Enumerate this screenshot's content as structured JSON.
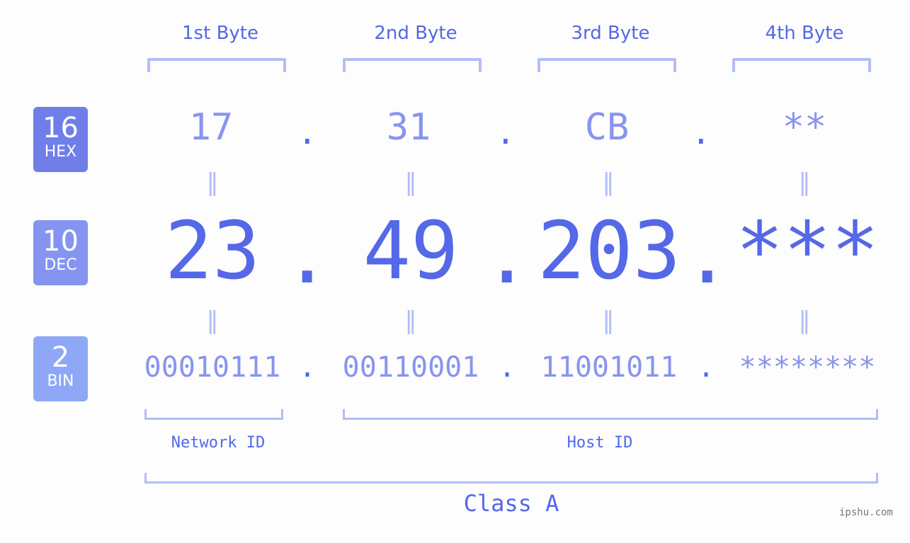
{
  "bytes": [
    {
      "header": "1st Byte",
      "hex": "17",
      "dec": "23",
      "bin": "00010111"
    },
    {
      "header": "2nd Byte",
      "hex": "31",
      "dec": "49",
      "bin": "00110001"
    },
    {
      "header": "3rd Byte",
      "hex": "CB",
      "dec": "203",
      "bin": "11001011"
    },
    {
      "header": "4th Byte",
      "hex": "**",
      "dec": "***",
      "bin": "********"
    }
  ],
  "separator": ".",
  "equals": "=",
  "bases": [
    {
      "num": "16",
      "label": "HEX",
      "color": "#6f7ee9"
    },
    {
      "num": "10",
      "label": "DEC",
      "color": "#8494f0"
    },
    {
      "num": "2",
      "label": "BIN",
      "color": "#8ea8f7"
    }
  ],
  "network_id_label": "Network ID",
  "host_id_label": "Host ID",
  "class_label": "Class A",
  "watermark": "ipshu.com"
}
